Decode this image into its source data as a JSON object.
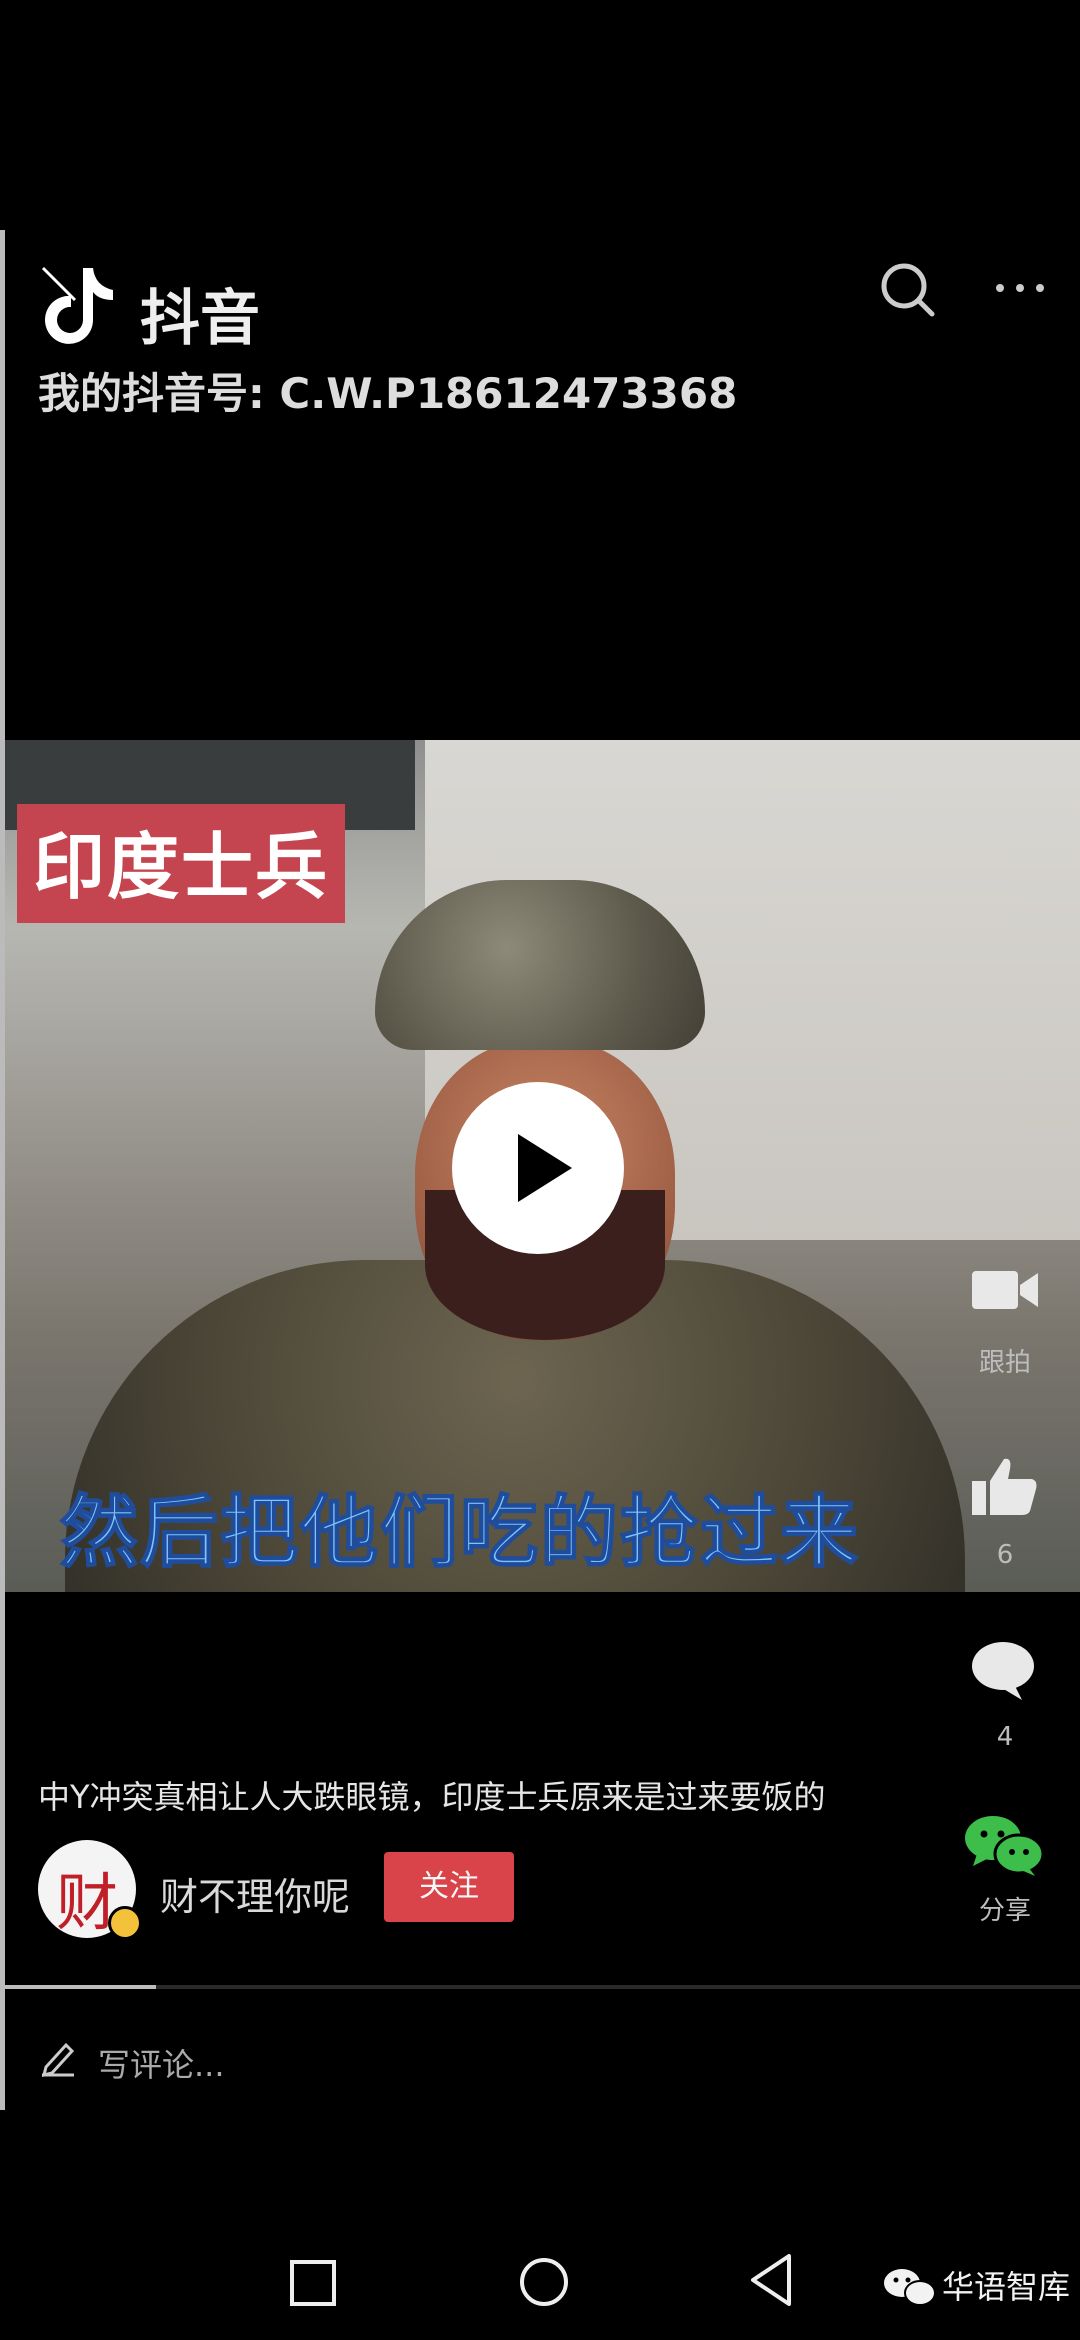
{
  "app": {
    "name": "抖音",
    "account_id": "我的抖音号: C.W.P18612473368"
  },
  "video": {
    "tag": "印度士兵",
    "subtitle": "然后把他们吃的抢过来",
    "progress": 0.14
  },
  "rail": {
    "camera_label": "跟拍",
    "like_count": "6",
    "comment_count": "4",
    "share_label": "分享"
  },
  "post": {
    "caption": "中Y冲突真相让人大跌眼镜，印度士兵原来是过来要饭的",
    "author": "财不理你呢",
    "avatar_char": "财",
    "follow_label": "关注"
  },
  "comment": {
    "placeholder": "写评论..."
  },
  "watermark": {
    "text": "华语智库"
  },
  "colors": {
    "tag_bg": "#c4454f",
    "follow": "#d9444a",
    "subtitle": "#7ec3ff",
    "share_green": "#3dbd4a"
  }
}
